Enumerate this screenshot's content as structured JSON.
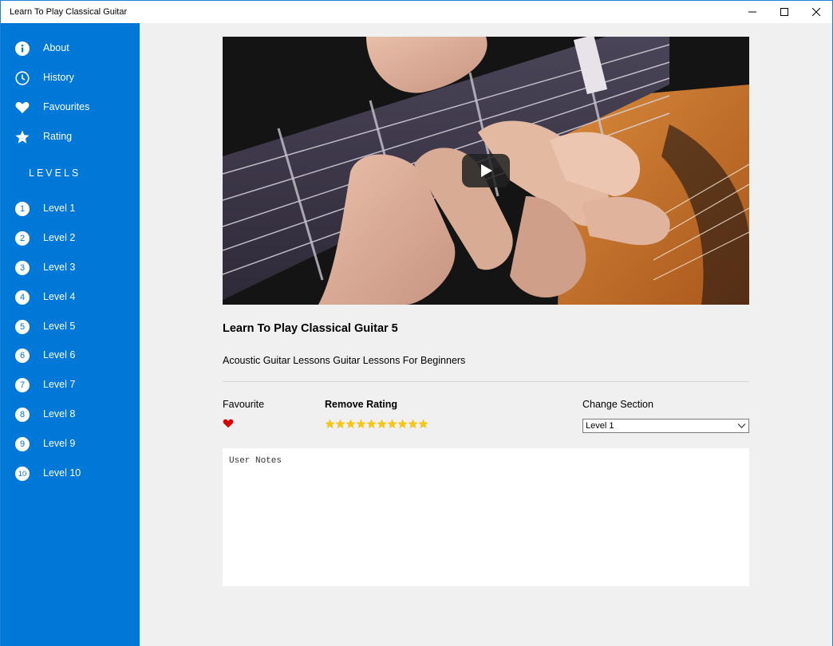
{
  "window": {
    "title": "Learn To Play Classical Guitar"
  },
  "sidebar": {
    "menu": [
      {
        "label": "About",
        "icon": "info-icon"
      },
      {
        "label": "History",
        "icon": "clock-icon"
      },
      {
        "label": "Favourites",
        "icon": "heart-icon"
      },
      {
        "label": "Rating",
        "icon": "star-icon"
      }
    ],
    "levels_header": "LEVELS",
    "levels": [
      {
        "num": "1",
        "label": "Level 1"
      },
      {
        "num": "2",
        "label": "Level 2"
      },
      {
        "num": "3",
        "label": "Level 3"
      },
      {
        "num": "4",
        "label": "Level 4"
      },
      {
        "num": "5",
        "label": "Level 5"
      },
      {
        "num": "6",
        "label": "Level 6"
      },
      {
        "num": "7",
        "label": "Level 7"
      },
      {
        "num": "8",
        "label": "Level 8"
      },
      {
        "num": "9",
        "label": "Level 9"
      },
      {
        "num": "10",
        "label": "Level 10"
      }
    ]
  },
  "video": {
    "title": "Learn To Play Classical Guitar 5",
    "description": "Acoustic Guitar Lessons Guitar Lessons For Beginners"
  },
  "controls": {
    "favourite_label": "Favourite",
    "rating_label": "Remove Rating",
    "rating_stars": 10,
    "section_label": "Change Section",
    "section_selected": "Level 1"
  },
  "notes": {
    "placeholder": "User Notes"
  },
  "colors": {
    "accent": "#0078d7",
    "heart": "#d40000",
    "star": "#f5c518",
    "background": "#f0f0f0"
  }
}
